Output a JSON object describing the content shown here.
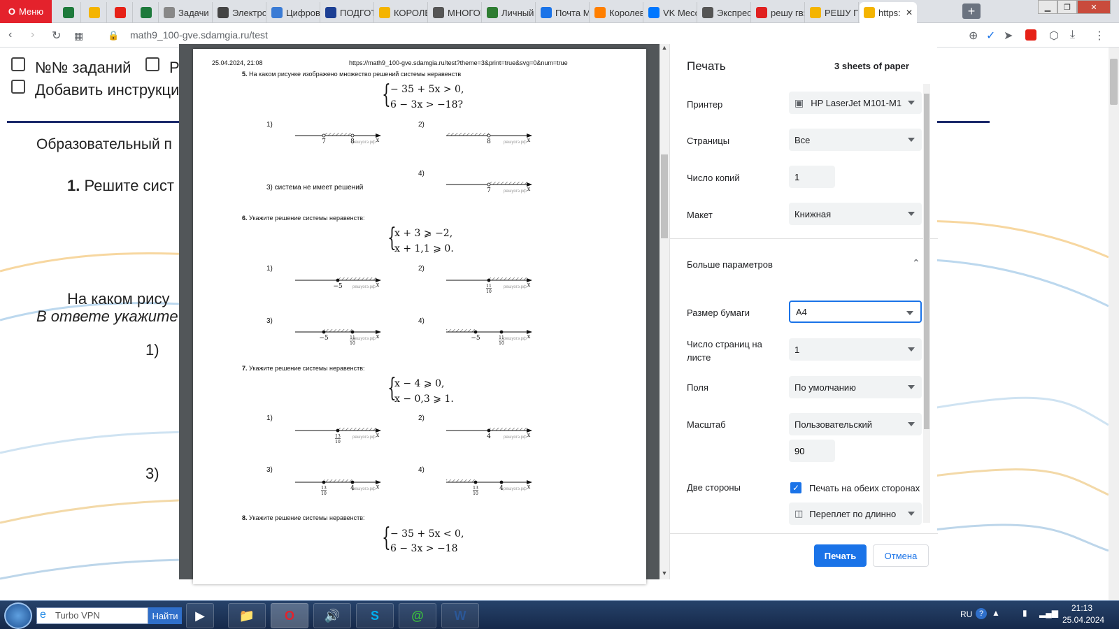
{
  "browser": {
    "menu_label": "Меню",
    "tabs": [
      {
        "label": "",
        "color": "#1e7a3c"
      },
      {
        "label": "",
        "color": "#f4b400"
      },
      {
        "label": "",
        "color": "#e62117"
      },
      {
        "label": "",
        "color": "#1e7a3c"
      },
      {
        "label": "Задачи N",
        "color": "#888888"
      },
      {
        "label": "Электро",
        "color": "#444444"
      },
      {
        "label": "Цифров",
        "color": "#3a7bd5"
      },
      {
        "label": "ПОДГОТ",
        "color": "#1c3f94"
      },
      {
        "label": "КОРОЛЕ",
        "color": "#f4b400"
      },
      {
        "label": "МНОГОК",
        "color": "#555555"
      },
      {
        "label": "Личный",
        "color": "#2e7d32"
      },
      {
        "label": "Почта М",
        "color": "#1a73e8"
      },
      {
        "label": "Королев",
        "color": "#ff7f00"
      },
      {
        "label": "VK Месс",
        "color": "#0077ff"
      },
      {
        "label": "Экспрес",
        "color": "#555555"
      },
      {
        "label": "решу гвз",
        "color": "#e02020"
      },
      {
        "label": "РЕШУ ГВ",
        "color": "#f4b400"
      },
      {
        "label": "https:",
        "color": "#f4b400"
      }
    ],
    "new_tab": "+",
    "url": "math9_100-gve.sdamgia.ru/test"
  },
  "page": {
    "opt1": "№№ заданий",
    "opt2": "Р",
    "opt3": "Добавить инструкци",
    "org": "Образовательный п",
    "q1_num": "1.",
    "q1_text": "Решите сист",
    "q_text": "На каком рису",
    "q_italic": "В ответе укажите н",
    "ans1": "1)",
    "ans3": "3)"
  },
  "sheet": {
    "header_date": "25.04.2024, 21:08",
    "header_url": "https://math9_100-gve.sdamgia.ru/test?theme=3&print=true&svg=0&num=true",
    "q5_num": "5.",
    "q5_text": "На каком рисунке изображено множество решений системы неравенств",
    "q5_line1": "− 35 + 5x > 0,",
    "q5_line2": "6 − 3x > −18?",
    "q5_a1": "1)",
    "q5_a2": "2)",
    "q5_a3": "3) система не имеет решений",
    "q5_a4": "4)",
    "q6_num": "6.",
    "q6_text": "Укажите решение системы неравенств:",
    "q6_line1": "x + 3 ⩾ −2,",
    "q6_line2": "x + 1,1 ⩾ 0.",
    "q7_num": "7.",
    "q7_text": "Укажите решение системы неравенств:",
    "q7_line1": "x − 4 ⩾ 0,",
    "q7_line2": "x − 0,3 ⩾ 1.",
    "q8_num": "8.",
    "q8_text": "Укажите решение системы неравенств:",
    "q8_line1": "− 35 + 5x < 0,",
    "q8_line2": "6 − 3x > −18",
    "n1": "1)",
    "n2": "2)",
    "n3": "3)",
    "n4": "4)",
    "watermark": "решуогэ.рф",
    "x": "x",
    "v7": "7",
    "v8": "8",
    "vm5": "−5",
    "v4": "4",
    "f11": "11",
    "f10": "10",
    "f13": "13"
  },
  "print_panel": {
    "title": "Печать",
    "sheets": "3 sheets of paper",
    "printer_label": "Принтер",
    "printer_value": "HP LaserJet M101-M1",
    "pages_label": "Страницы",
    "pages_value": "Все",
    "copies_label": "Число копий",
    "copies_value": "1",
    "layout_label": "Макет",
    "layout_value": "Книжная",
    "more_label": "Больше параметров",
    "paper_label": "Размер бумаги",
    "paper_value": "A4",
    "pps_label": "Число страниц на листе",
    "pps_value": "1",
    "margins_label": "Поля",
    "margins_value": "По умолчанию",
    "scale_label": "Масштаб",
    "scale_value": "Пользовательский",
    "scale_num": "90",
    "duplex_label": "Две стороны",
    "duplex_check": "Печать на обеих сторонах",
    "duplex_mode": "Переплет по длинно",
    "print_btn": "Печать",
    "cancel_btn": "Отмена"
  },
  "taskbar": {
    "search_placeholder": "Turbo VPN",
    "search_btn": "Найти",
    "lang": "RU",
    "time": "21:13",
    "date": "25.04.2024"
  }
}
